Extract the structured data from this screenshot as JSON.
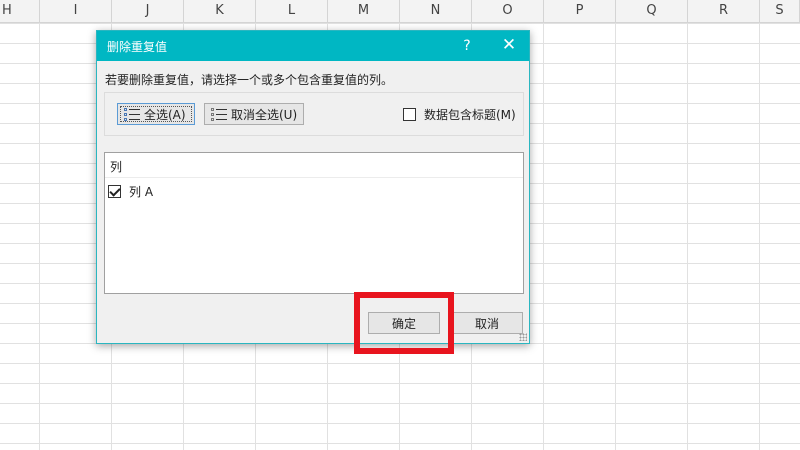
{
  "sheet": {
    "columns": [
      "H",
      "I",
      "J",
      "K",
      "L",
      "M",
      "N",
      "O",
      "P",
      "Q",
      "R",
      "S"
    ]
  },
  "dialog": {
    "title": "删除重复值",
    "help_label": "?",
    "close_label": "✕",
    "instruction": "若要删除重复值，请选择一个或多个包含重复值的列。",
    "select_all_label": "全选(A)",
    "unselect_all_label": "取消全选(U)",
    "header_checkbox_label": "数据包含标题(M)",
    "header_checkbox_checked": false,
    "list_header": "列",
    "list_items": [
      {
        "label": "列 A",
        "checked": true
      }
    ],
    "ok_label": "确定",
    "cancel_label": "取消"
  },
  "colors": {
    "titlebar": "#00b7c3",
    "highlight": "#e8141e"
  }
}
